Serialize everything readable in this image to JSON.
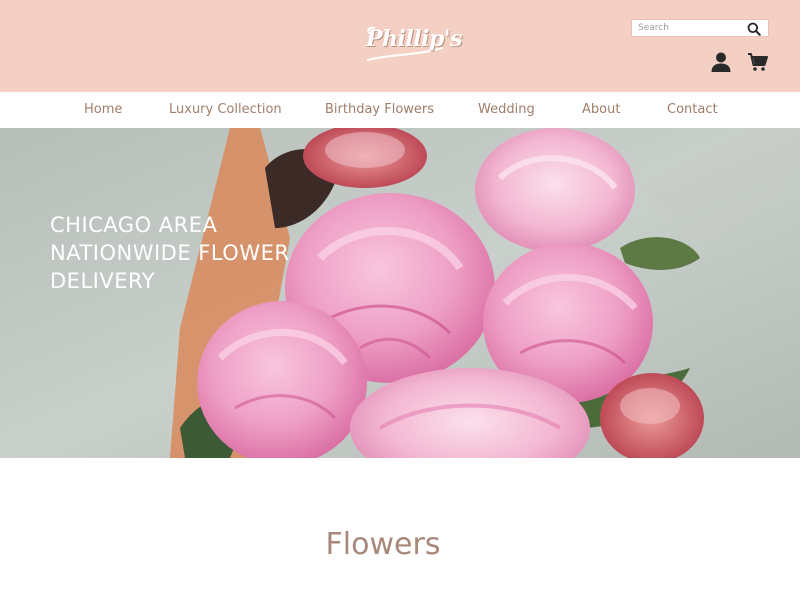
{
  "header": {
    "logo_text": "Phillip's",
    "background_color": "#f3d0c3",
    "search": {
      "placeholder": "Search",
      "icon": "search-icon"
    },
    "account_icon": "user-icon",
    "cart_icon": "cart-icon"
  },
  "nav": {
    "items": [
      {
        "label": "Home"
      },
      {
        "label": "Luxury Collection"
      },
      {
        "label": "Birthday Flowers"
      },
      {
        "label": "Wedding"
      },
      {
        "label": "About"
      },
      {
        "label": "Contact"
      }
    ],
    "text_color": "#a07e6a"
  },
  "hero": {
    "line1": "CHICAGO AREA",
    "line2": "NATIONWIDE FLOWER",
    "line3": "DELIVERY"
  },
  "section": {
    "title": "Flowers",
    "title_color": "#a8887a"
  }
}
